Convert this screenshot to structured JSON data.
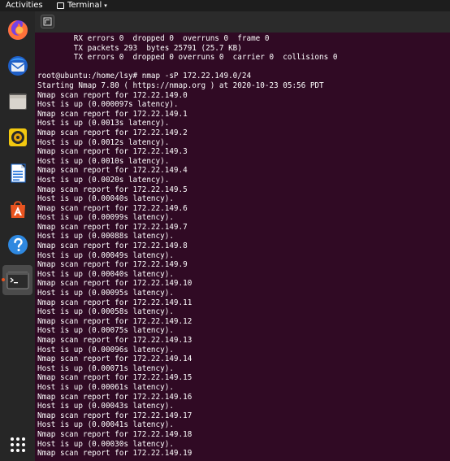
{
  "topbar": {
    "activities": "Activities",
    "app_name": "Terminal",
    "caret": "▾"
  },
  "dock": {
    "items": [
      {
        "name": "firefox-icon",
        "color": "#e66000"
      },
      {
        "name": "thunderbird-icon",
        "color": "#2f6fd6"
      },
      {
        "name": "files-icon",
        "color": "#d8d4cd"
      },
      {
        "name": "rhythmbox-icon",
        "color": "#f2c80f"
      },
      {
        "name": "libreoffice-writer-icon",
        "color": "#1d6fd8"
      },
      {
        "name": "software-center-icon",
        "color": "#e95420"
      },
      {
        "name": "help-icon",
        "color": "#2e88e0"
      },
      {
        "name": "terminal-icon",
        "color": "#2b2b2b"
      },
      {
        "name": "show-applications-icon",
        "color": "#ffffff"
      }
    ]
  },
  "terminal": {
    "lines": [
      "        RX errors 0  dropped 0  overruns 0  frame 0",
      "        TX packets 293  bytes 25791 (25.7 KB)",
      "        TX errors 0  dropped 0 overruns 0  carrier 0  collisions 0",
      "",
      "root@ubuntu:/home/lsy# nmap -sP 172.22.149.0/24",
      "Starting Nmap 7.80 ( https://nmap.org ) at 2020-10-23 05:56 PDT",
      "Nmap scan report for 172.22.149.0",
      "Host is up (0.000097s latency).",
      "Nmap scan report for 172.22.149.1",
      "Host is up (0.0013s latency).",
      "Nmap scan report for 172.22.149.2",
      "Host is up (0.0012s latency).",
      "Nmap scan report for 172.22.149.3",
      "Host is up (0.0010s latency).",
      "Nmap scan report for 172.22.149.4",
      "Host is up (0.0020s latency).",
      "Nmap scan report for 172.22.149.5",
      "Host is up (0.00040s latency).",
      "Nmap scan report for 172.22.149.6",
      "Host is up (0.00099s latency).",
      "Nmap scan report for 172.22.149.7",
      "Host is up (0.00088s latency).",
      "Nmap scan report for 172.22.149.8",
      "Host is up (0.00049s latency).",
      "Nmap scan report for 172.22.149.9",
      "Host is up (0.00040s latency).",
      "Nmap scan report for 172.22.149.10",
      "Host is up (0.00095s latency).",
      "Nmap scan report for 172.22.149.11",
      "Host is up (0.00058s latency).",
      "Nmap scan report for 172.22.149.12",
      "Host is up (0.00075s latency).",
      "Nmap scan report for 172.22.149.13",
      "Host is up (0.00096s latency).",
      "Nmap scan report for 172.22.149.14",
      "Host is up (0.00071s latency).",
      "Nmap scan report for 172.22.149.15",
      "Host is up (0.00061s latency).",
      "Nmap scan report for 172.22.149.16",
      "Host is up (0.00043s latency).",
      "Nmap scan report for 172.22.149.17",
      "Host is up (0.00041s latency).",
      "Nmap scan report for 172.22.149.18",
      "Host is up (0.00030s latency).",
      "Nmap scan report for 172.22.149.19"
    ]
  }
}
